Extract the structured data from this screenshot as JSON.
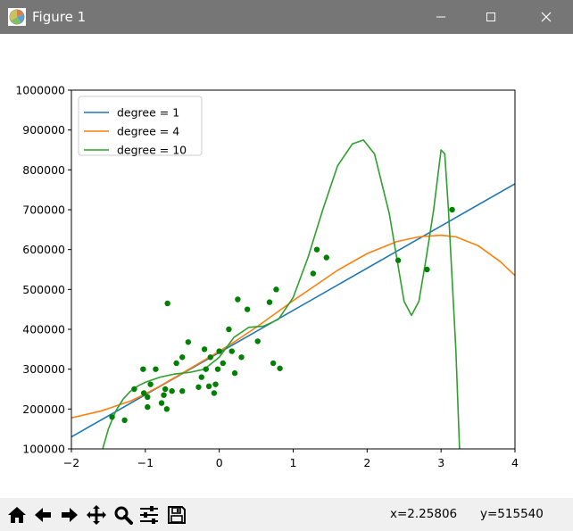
{
  "window": {
    "title": "Figure 1",
    "icon": "matplotlib-icon",
    "controls": [
      "minimize-icon",
      "maximize-icon",
      "close-icon"
    ]
  },
  "toolbar": {
    "buttons": [
      "home-icon",
      "back-arrow-icon",
      "forward-arrow-icon",
      "pan-icon",
      "zoom-icon",
      "subplots-config-icon",
      "save-icon"
    ],
    "coord_x": "x=2.25806",
    "coord_y": "y=515540"
  },
  "chart_data": {
    "type": "scatter",
    "title": "",
    "xlabel": "",
    "ylabel": "",
    "xlim": [
      -2,
      4
    ],
    "ylim": [
      100000,
      1000000
    ],
    "xticks": [
      "-2",
      "-1",
      "0",
      "1",
      "2",
      "3",
      "4"
    ],
    "yticks": [
      "100000",
      "200000",
      "300000",
      "400000",
      "500000",
      "600000",
      "700000",
      "800000",
      "900000",
      "1000000"
    ],
    "grid": false,
    "legend_position": "top-left",
    "scatter": {
      "color": "#008000",
      "points": [
        [
          -1.45,
          180000
        ],
        [
          -1.28,
          172000
        ],
        [
          -1.15,
          250000
        ],
        [
          -1.03,
          300000
        ],
        [
          -1.02,
          240000
        ],
        [
          -0.97,
          205000
        ],
        [
          -0.97,
          230000
        ],
        [
          -0.93,
          262000
        ],
        [
          -0.86,
          300000
        ],
        [
          -0.78,
          215000
        ],
        [
          -0.75,
          235000
        ],
        [
          -0.73,
          250000
        ],
        [
          -0.71,
          200000
        ],
        [
          -0.7,
          465000
        ],
        [
          -0.64,
          245000
        ],
        [
          -0.58,
          315000
        ],
        [
          -0.5,
          330000
        ],
        [
          -0.5,
          245000
        ],
        [
          -0.42,
          368000
        ],
        [
          -0.28,
          255000
        ],
        [
          -0.24,
          280000
        ],
        [
          -0.2,
          350000
        ],
        [
          -0.18,
          300000
        ],
        [
          -0.14,
          257000
        ],
        [
          -0.12,
          330000
        ],
        [
          -0.07,
          240000
        ],
        [
          -0.05,
          262000
        ],
        [
          -0.02,
          300000
        ],
        [
          0.0,
          345000
        ],
        [
          0.05,
          315000
        ],
        [
          0.13,
          400000
        ],
        [
          0.17,
          345000
        ],
        [
          0.21,
          290000
        ],
        [
          0.25,
          475000
        ],
        [
          0.3,
          330000
        ],
        [
          0.38,
          450000
        ],
        [
          0.52,
          370000
        ],
        [
          0.68,
          468000
        ],
        [
          0.73,
          315000
        ],
        [
          0.77,
          500000
        ],
        [
          0.82,
          302000
        ],
        [
          1.27,
          540000
        ],
        [
          1.32,
          600000
        ],
        [
          1.45,
          580000
        ],
        [
          2.42,
          573000
        ],
        [
          2.81,
          550000
        ],
        [
          3.15,
          700000
        ]
      ]
    },
    "series": [
      {
        "name": "degree = 1",
        "color": "#1f77b4",
        "x": [
          -2,
          4
        ],
        "y": [
          130000,
          765000
        ]
      },
      {
        "name": "degree = 4",
        "color": "#ff7f0e",
        "x": [
          -2.0,
          -1.6,
          -1.2,
          -1.0,
          -0.8,
          -0.5,
          -0.2,
          0.0,
          0.2,
          0.5,
          0.8,
          1.0,
          1.3,
          1.6,
          2.0,
          2.4,
          2.7,
          3.0,
          3.2,
          3.5,
          3.8,
          4.0
        ],
        "y": [
          178000,
          195000,
          220000,
          238000,
          258000,
          290000,
          323000,
          345000,
          368000,
          405000,
          445000,
          472000,
          510000,
          548000,
          590000,
          620000,
          632000,
          636000,
          632000,
          610000,
          570000,
          535000
        ]
      },
      {
        "name": "degree = 10",
        "color": "#2ca02c",
        "x": [
          -1.6,
          -1.5,
          -1.4,
          -1.3,
          -1.2,
          -1.1,
          -1.0,
          -0.8,
          -0.6,
          -0.4,
          -0.2,
          0.0,
          0.2,
          0.4,
          0.6,
          0.8,
          1.0,
          1.2,
          1.4,
          1.6,
          1.8,
          1.95,
          2.1,
          2.3,
          2.5,
          2.6,
          2.7,
          2.8,
          2.9,
          3.0,
          3.05,
          3.1,
          3.2,
          3.25,
          3.28
        ],
        "y": [
          85000,
          150000,
          195000,
          225000,
          245000,
          258000,
          267000,
          280000,
          288000,
          292000,
          300000,
          330000,
          380000,
          405000,
          408000,
          425000,
          480000,
          580000,
          700000,
          810000,
          865000,
          875000,
          840000,
          690000,
          470000,
          435000,
          470000,
          580000,
          700000,
          850000,
          840000,
          700000,
          350000,
          100000,
          70000
        ]
      }
    ]
  }
}
